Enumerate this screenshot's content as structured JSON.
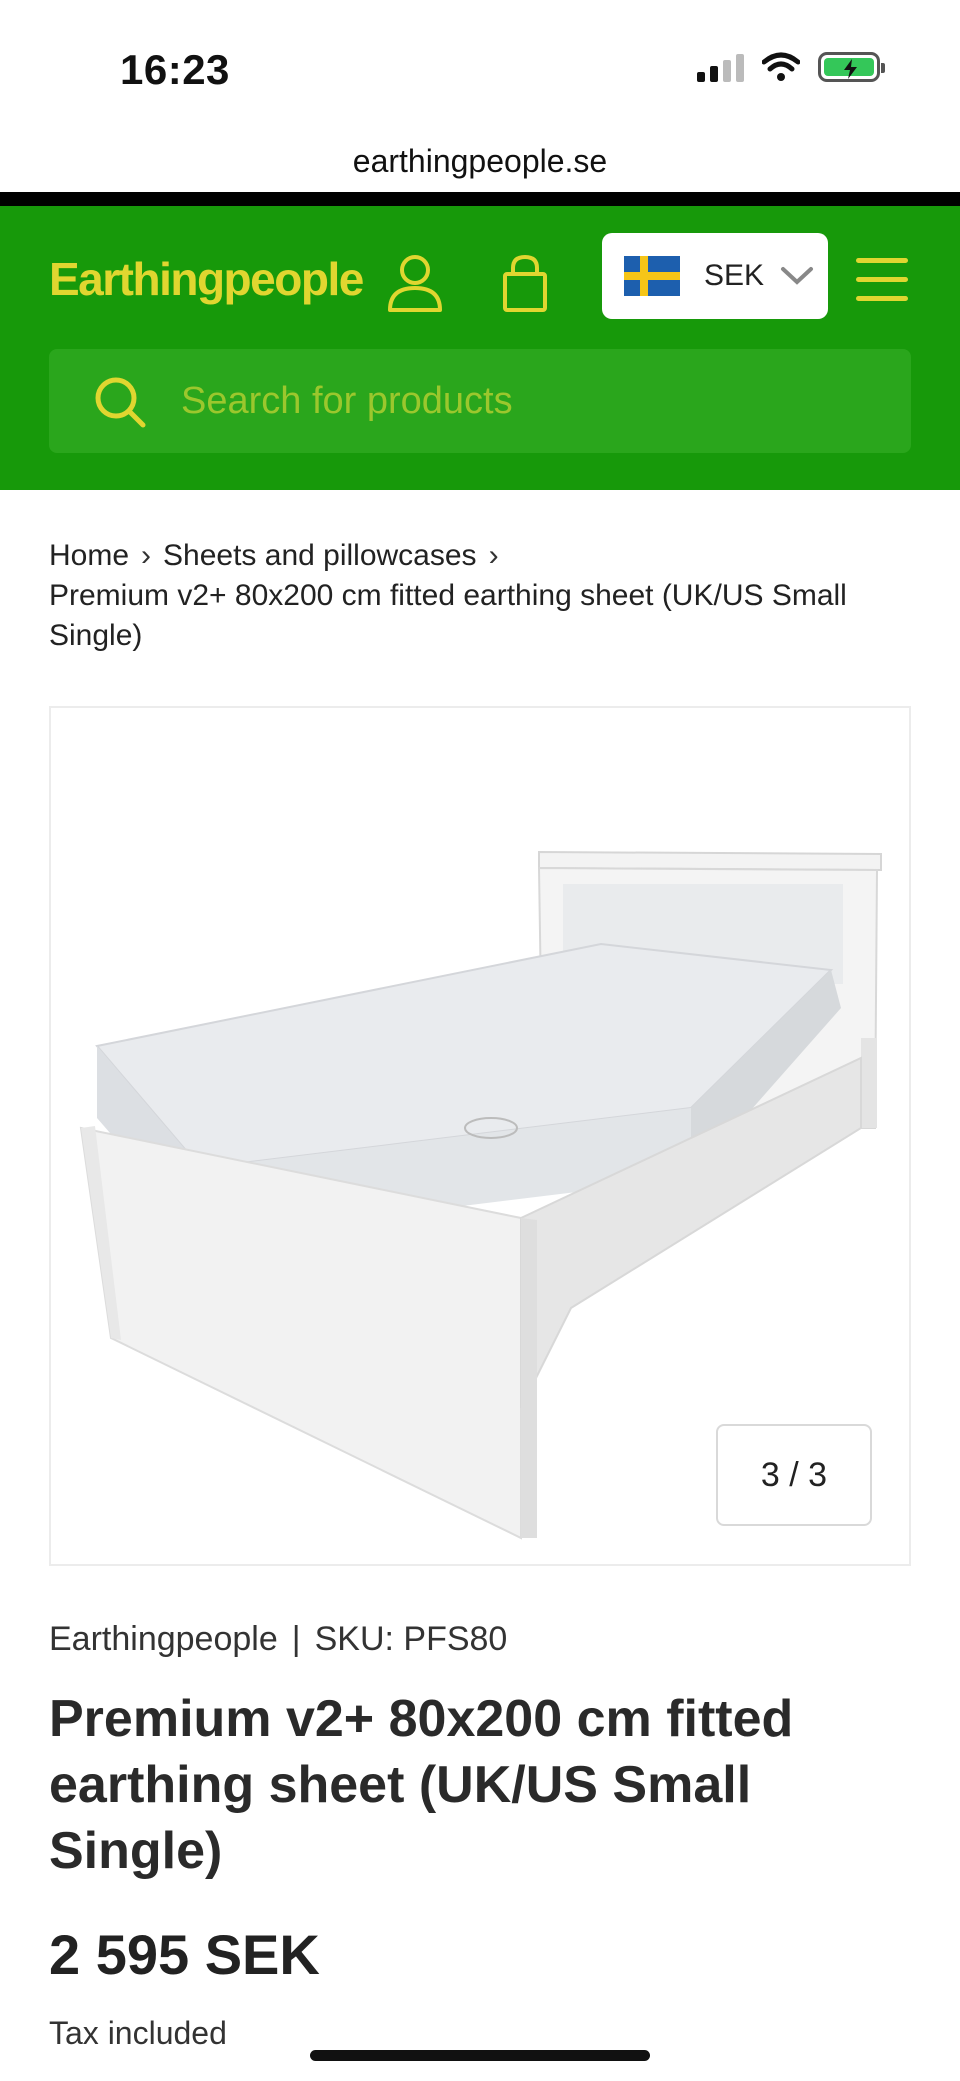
{
  "status_bar": {
    "time": "16:23"
  },
  "browser": {
    "url": "earthingpeople.se"
  },
  "header": {
    "logo": "Earthingpeople",
    "currency": "SEK",
    "search_placeholder": "Search for products",
    "colors": {
      "background": "#17990a",
      "accent": "#e0d630"
    }
  },
  "breadcrumb": {
    "items": [
      "Home",
      "Sheets and pillowcases"
    ],
    "current": "Premium v2+ 80x200 cm fitted earthing sheet (UK/US Small Single)"
  },
  "gallery": {
    "counter": "3 / 3",
    "image": "bed-with-fitted-sheet"
  },
  "product": {
    "brand": "Earthingpeople",
    "sku": "SKU: PFS80",
    "title": "Premium v2+ 80x200 cm fitted earthing sheet (UK/US Small Single)",
    "price": "2 595 SEK",
    "tax_note": "Tax included"
  }
}
